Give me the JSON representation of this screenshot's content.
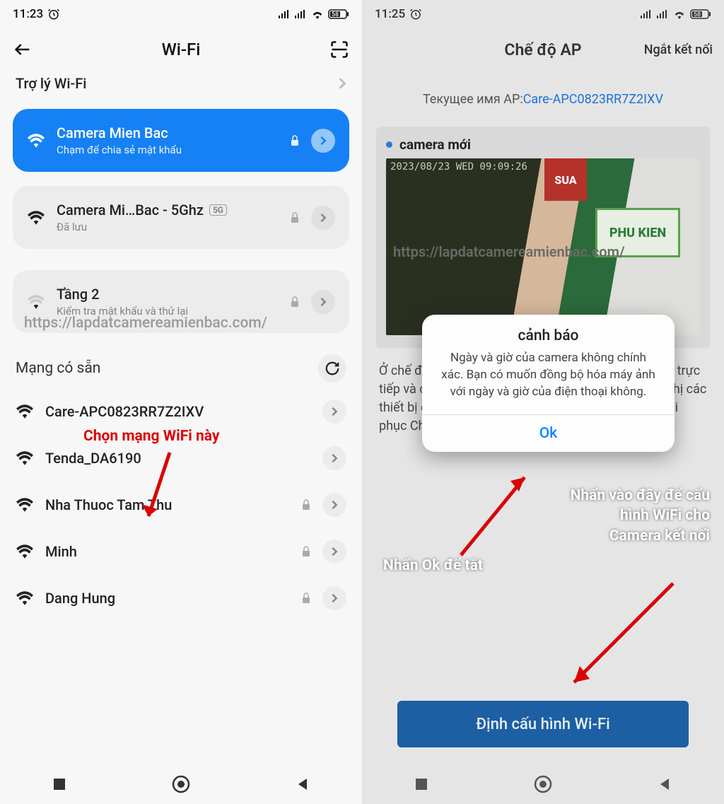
{
  "left": {
    "status": {
      "time": "11:23",
      "battery": "58"
    },
    "header": {
      "title": "Wi-Fi"
    },
    "assistant_label": "Trợ lý Wi-Fi",
    "connected": {
      "name": "Camera Mien Bac",
      "sub": "Chạm để chia sẻ mật khẩu"
    },
    "saved": [
      {
        "name": "Camera Mi…Bac - 5Ghz",
        "sub": "Đã lưu",
        "badge": "5G"
      },
      {
        "name": "Tầng 2",
        "sub": "Kiểm tra mật khẩu và thử lại"
      }
    ],
    "watermark": "https://lapdatcamereamienbac.com/",
    "annot_choose": "Chọn mạng WiFi này",
    "available_label": "Mạng có sẵn",
    "networks": [
      {
        "name": "Care-APC0823RR7Z2IXV",
        "locked": false
      },
      {
        "name": "Tenda_DA6190",
        "locked": false
      },
      {
        "name": "Nha Thuoc Tam Thu",
        "locked": true
      },
      {
        "name": "Minh",
        "locked": true
      },
      {
        "name": "Dang Hung",
        "locked": true
      }
    ]
  },
  "right": {
    "status": {
      "time": "11:25",
      "battery": "58"
    },
    "header": {
      "title": "Chế độ AP",
      "disconnect": "Ngắt kết nối"
    },
    "ap_label": "Текущее имя AP:",
    "ap_name": "Care-APC0823RR7Z2IXV",
    "camera_name": "camera mới",
    "preview_ts": "2023/08/23 WED 09:09:26",
    "preview_wm": "https://lapdatcamereamienbac.com/",
    "preview_sign": "PHU KIEN",
    "preview_redsign": "SUA",
    "info_text": "Ở chế độ AP, bạn có thể nhấp vào thẻ thiết bị để xem trực tiếp và chi được phép xem từng lần một và chỉ hiển thị các thiết bị đã thêm. Ngắt kết nối điểm phát sóng để khôi phục Chế độ thông thường",
    "dialog": {
      "title": "cảnh báo",
      "msg": "Ngày và giờ của camera không chính xác. Bạn có muốn đồng bộ hóa máy ảnh với ngày và giờ của điện thoại không.",
      "ok": "Ok"
    },
    "annot_ok": "Nhấn Ok để tắt",
    "annot_cfg": "Nhấn vào đây để cấu hình WiFi cho Camera kết nối",
    "cfg_button": "Định cấu hình Wi-Fi"
  }
}
